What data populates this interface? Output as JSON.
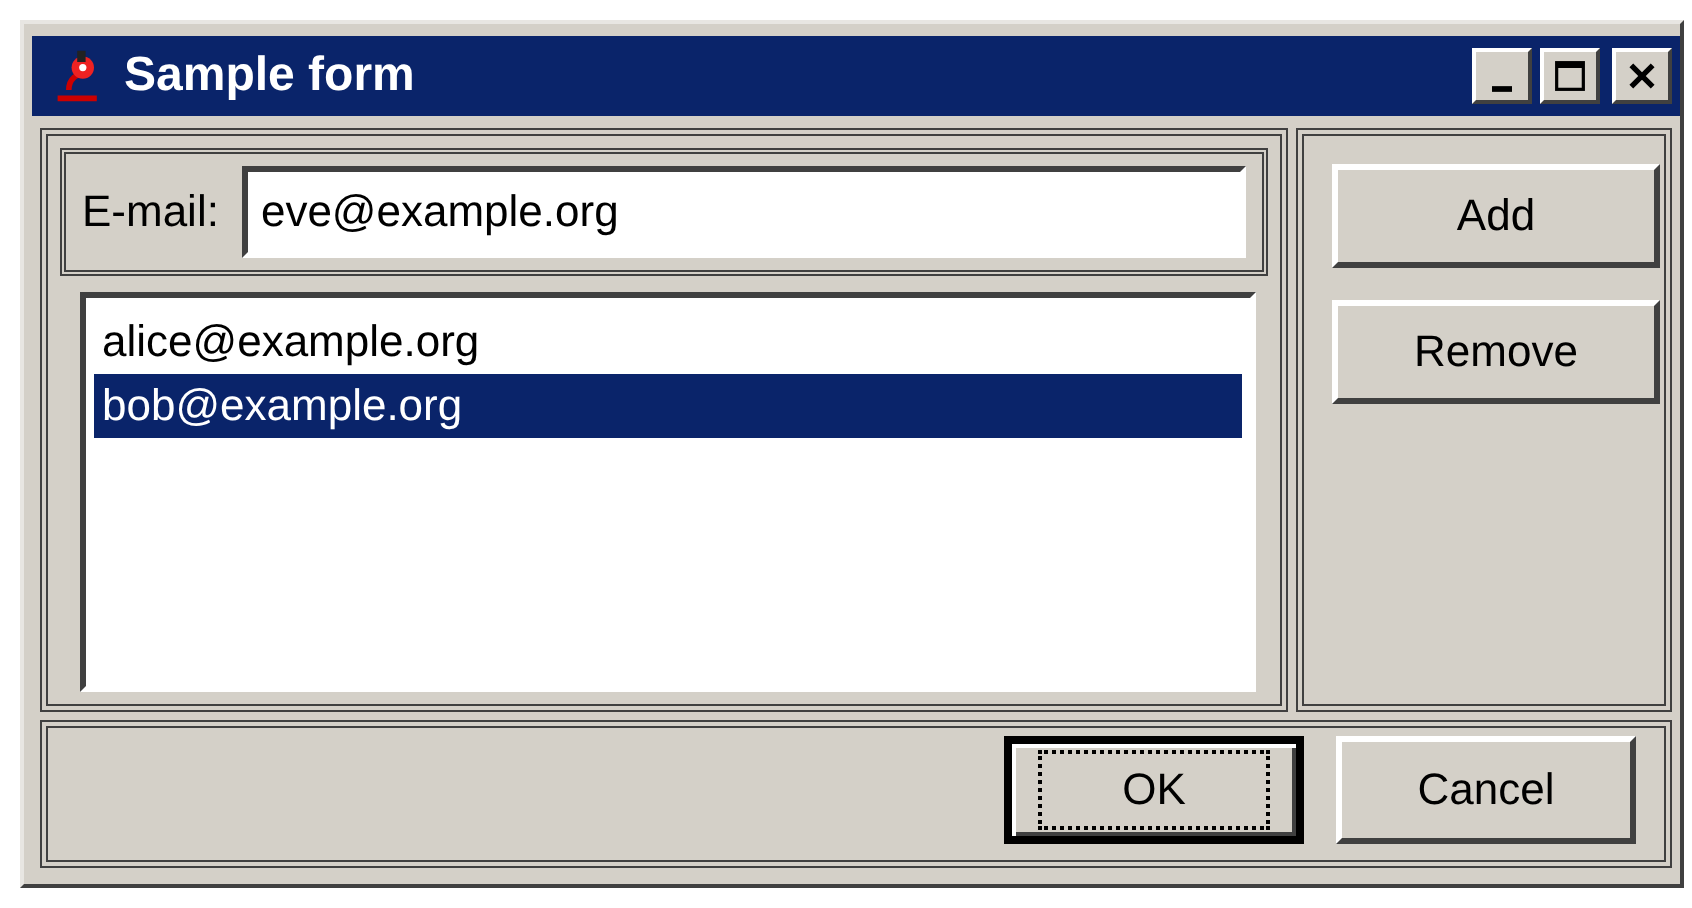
{
  "window": {
    "title": "Sample form"
  },
  "email": {
    "label": "E-mail:",
    "value": "eve@example.org"
  },
  "list": [
    {
      "text": "alice@example.org",
      "selected": false
    },
    {
      "text": "bob@example.org",
      "selected": true
    }
  ],
  "side_buttons": [
    "Add",
    "Remove"
  ],
  "footer_buttons": [
    {
      "label": "OK",
      "default": true
    },
    {
      "label": "Cancel",
      "default": false
    }
  ]
}
